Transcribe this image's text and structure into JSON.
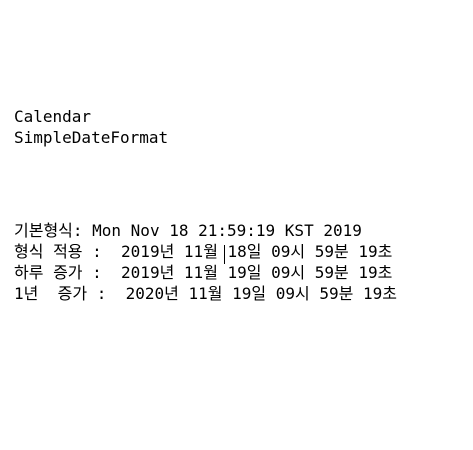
{
  "headers": {
    "line1": "Calendar",
    "line2": "SimpleDateFormat"
  },
  "output": {
    "default_format": "기본형식: Mon Nov 18 21:59:19 KST 2019",
    "formatted": "형식 적용 :  2019년 11월 18일 09시 59분 19초",
    "day_added": "하루 증가 :  2019년 11월 19일 09시 59분 19초",
    "year_added": "1년  증가 :  2020년 11월 19일 09시 59분 19초"
  }
}
